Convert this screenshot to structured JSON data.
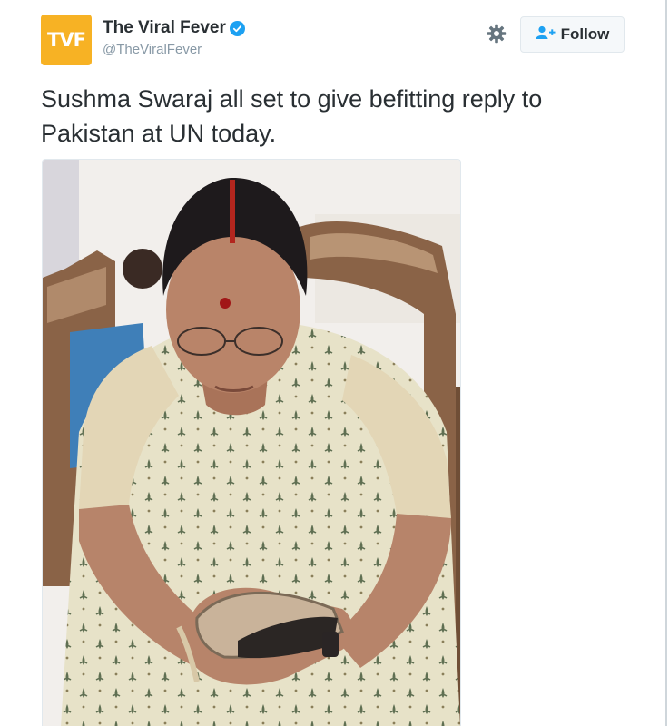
{
  "account": {
    "display_name": "The Viral Fever",
    "handle": "@TheViralFever",
    "avatar_text": "TVF",
    "avatar_color": "#f7b224",
    "verified": true
  },
  "actions": {
    "settings_icon": "gear-icon",
    "follow_label": "Follow",
    "follow_icon": "add-user-icon"
  },
  "tweet": {
    "text": "Sushma Swaraj all set to give befitting reply to Pakistan at UN today."
  },
  "media": {
    "type": "photo",
    "accent_color": "#1da1f2"
  }
}
